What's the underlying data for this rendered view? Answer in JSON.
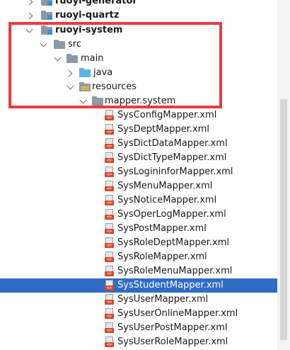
{
  "tree": {
    "modules": [
      {
        "label": "ruoyi-generator"
      },
      {
        "label": "ruoyi-quartz"
      },
      {
        "label": "ruoyi-system"
      }
    ],
    "src": "src",
    "main": "main",
    "java": "java",
    "resources": "resources",
    "mapper_package": "mapper.system",
    "files": [
      "SysConfigMapper.xml",
      "SysDeptMapper.xml",
      "SysDictDataMapper.xml",
      "SysDictTypeMapper.xml",
      "SysLogininforMapper.xml",
      "SysMenuMapper.xml",
      "SysNoticeMapper.xml",
      "SysOperLogMapper.xml",
      "SysPostMapper.xml",
      "SysRoleDeptMapper.xml",
      "SysRoleMapper.xml",
      "SysRoleMenuMapper.xml",
      "SysStudentMapper.xml",
      "SysUserMapper.xml",
      "SysUserOnlineMapper.xml",
      "SysUserPostMapper.xml",
      "SysUserRoleMapper.xml"
    ],
    "selected_file": "SysStudentMapper.xml",
    "colors": {
      "selection": "#2f6cc4",
      "highlight_border": "#f0393e"
    }
  }
}
